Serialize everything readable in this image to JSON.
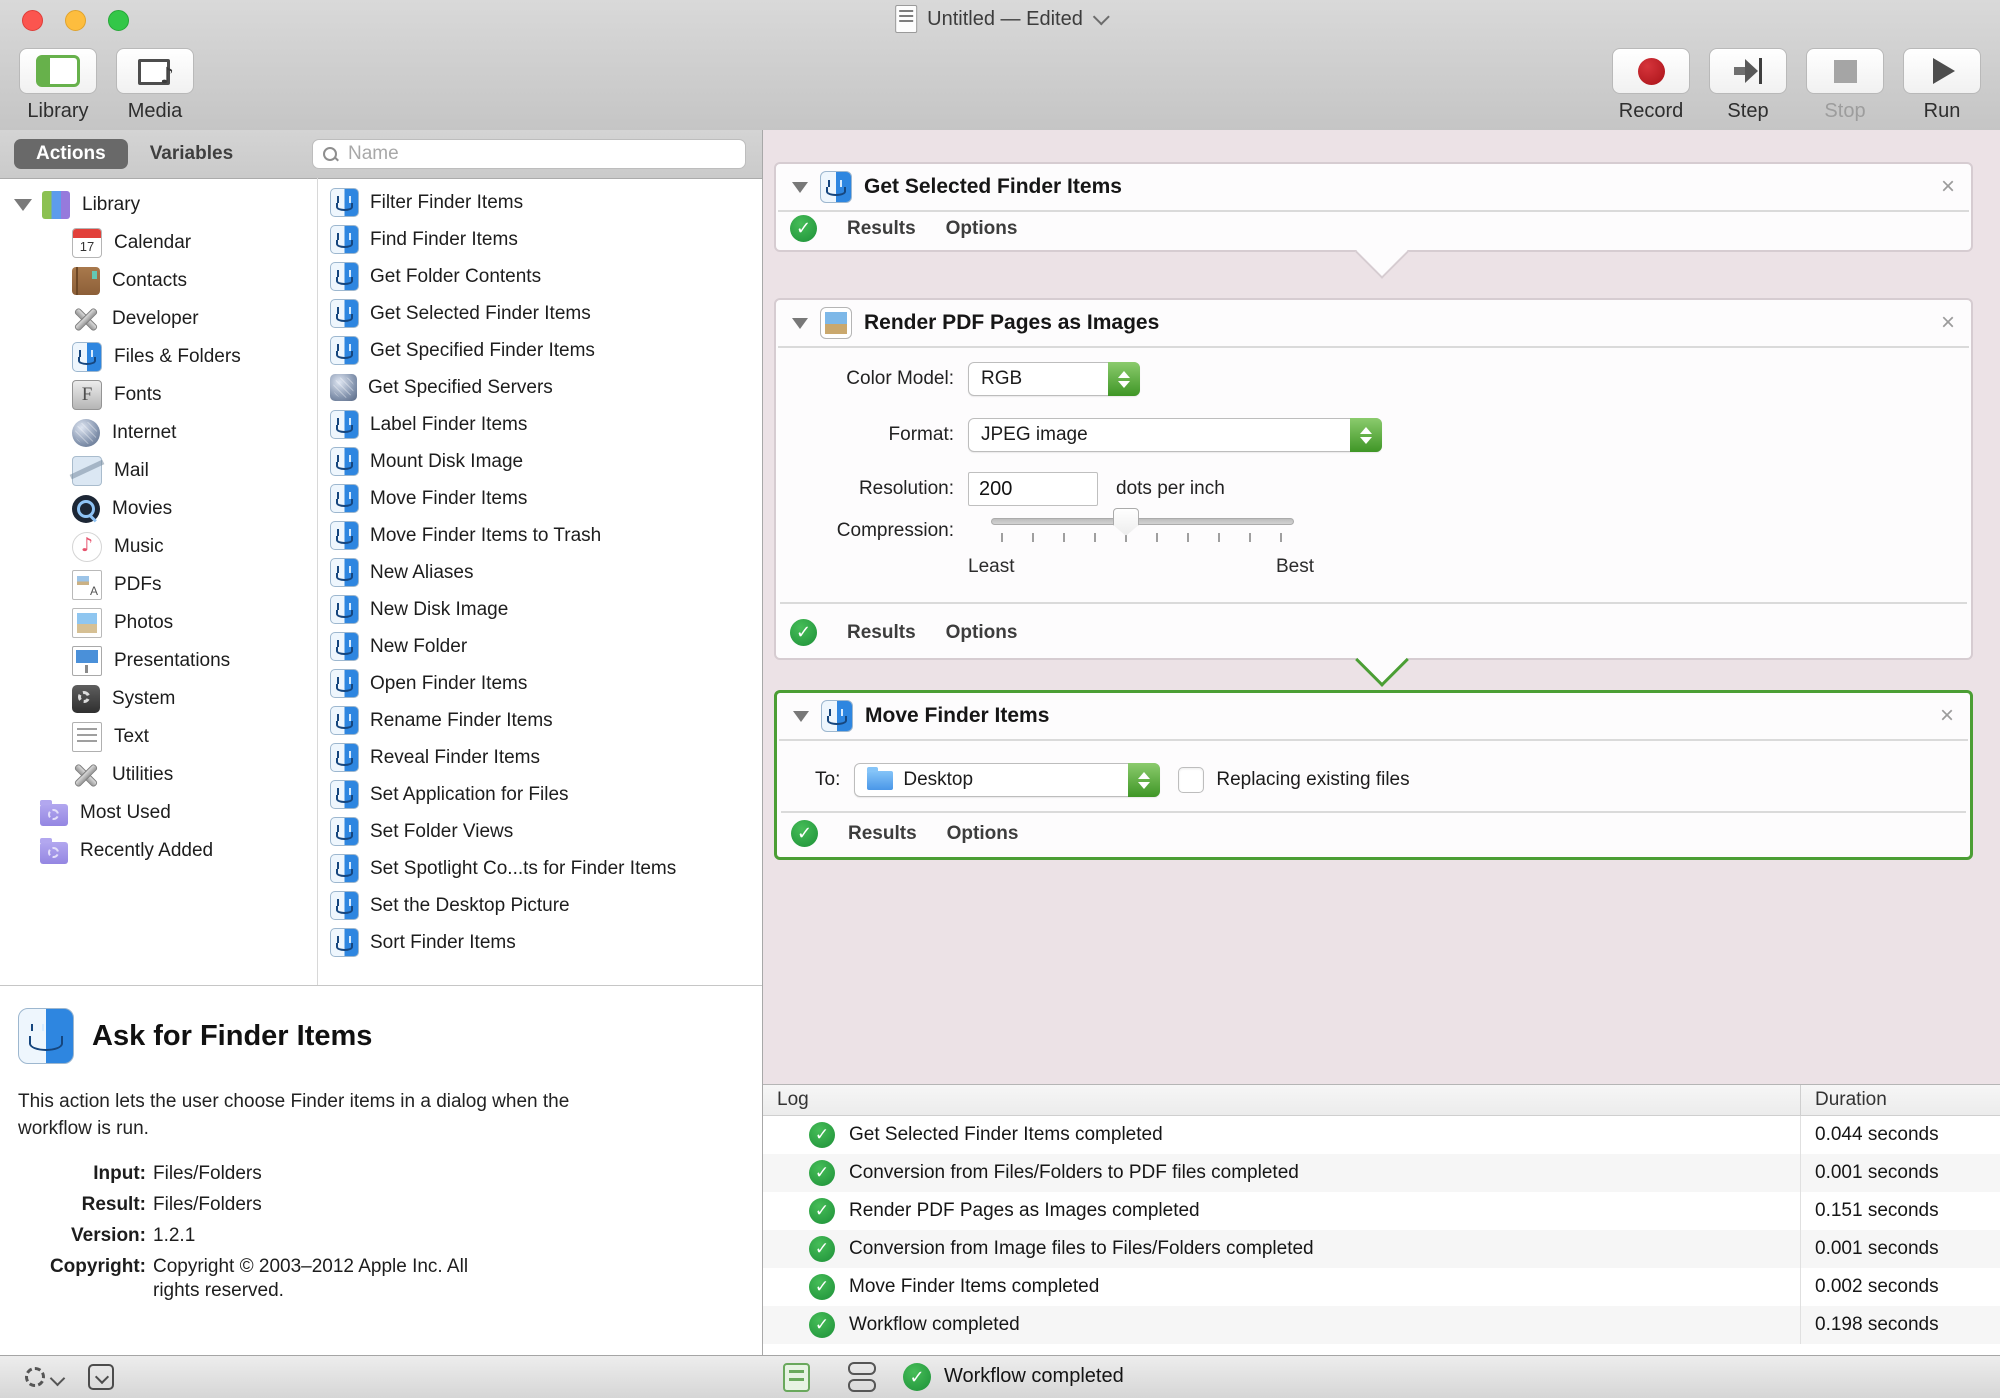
{
  "window": {
    "title": "Untitled — Edited"
  },
  "toolbar": {
    "library_label": "Library",
    "media_label": "Media",
    "record_label": "Record",
    "step_label": "Step",
    "stop_label": "Stop",
    "stop_disabled": true,
    "run_label": "Run"
  },
  "tabs": {
    "items": [
      {
        "label": "Actions",
        "selected": true
      },
      {
        "label": "Variables",
        "selected": false
      }
    ]
  },
  "search": {
    "placeholder": "Name"
  },
  "sidebar": {
    "items": [
      {
        "label": "Library",
        "icon": "library",
        "level": 0,
        "expanded": true,
        "selected": false
      },
      {
        "label": "Calendar",
        "icon": "calendar",
        "level": 1,
        "selected": false
      },
      {
        "label": "Contacts",
        "icon": "contacts",
        "level": 1,
        "selected": false
      },
      {
        "label": "Developer",
        "icon": "developer",
        "level": 1,
        "selected": false
      },
      {
        "label": "Files & Folders",
        "icon": "finder",
        "level": 1,
        "selected": true
      },
      {
        "label": "Fonts",
        "icon": "fonts",
        "level": 1,
        "selected": false
      },
      {
        "label": "Internet",
        "icon": "internet",
        "level": 1,
        "selected": false
      },
      {
        "label": "Mail",
        "icon": "mail",
        "level": 1,
        "selected": false
      },
      {
        "label": "Movies",
        "icon": "movies",
        "level": 1,
        "selected": false
      },
      {
        "label": "Music",
        "icon": "music",
        "level": 1,
        "selected": false
      },
      {
        "label": "PDFs",
        "icon": "pdfs",
        "level": 1,
        "selected": false
      },
      {
        "label": "Photos",
        "icon": "photos",
        "level": 1,
        "selected": false
      },
      {
        "label": "Presentations",
        "icon": "presentations",
        "level": 1,
        "selected": false
      },
      {
        "label": "System",
        "icon": "system",
        "level": 1,
        "selected": false
      },
      {
        "label": "Text",
        "icon": "text",
        "level": 1,
        "selected": false
      },
      {
        "label": "Utilities",
        "icon": "utilities",
        "level": 1,
        "selected": false
      },
      {
        "label": "Most Used",
        "icon": "smart-folder",
        "level": 2,
        "selected": false
      },
      {
        "label": "Recently Added",
        "icon": "smart-folder",
        "level": 2,
        "selected": false
      }
    ]
  },
  "actions_list": {
    "items": [
      {
        "label": "Filter Finder Items",
        "icon": "finder"
      },
      {
        "label": "Find Finder Items",
        "icon": "finder"
      },
      {
        "label": "Get Folder Contents",
        "icon": "finder"
      },
      {
        "label": "Get Selected Finder Items",
        "icon": "finder"
      },
      {
        "label": "Get Specified Finder Items",
        "icon": "finder"
      },
      {
        "label": "Get Specified Servers",
        "icon": "globe"
      },
      {
        "label": "Label Finder Items",
        "icon": "finder"
      },
      {
        "label": "Mount Disk Image",
        "icon": "finder"
      },
      {
        "label": "Move Finder Items",
        "icon": "finder"
      },
      {
        "label": "Move Finder Items to Trash",
        "icon": "finder"
      },
      {
        "label": "New Aliases",
        "icon": "finder"
      },
      {
        "label": "New Disk Image",
        "icon": "finder"
      },
      {
        "label": "New Folder",
        "icon": "finder"
      },
      {
        "label": "Open Finder Items",
        "icon": "finder"
      },
      {
        "label": "Rename Finder Items",
        "icon": "finder"
      },
      {
        "label": "Reveal Finder Items",
        "icon": "finder"
      },
      {
        "label": "Set Application for Files",
        "icon": "finder"
      },
      {
        "label": "Set Folder Views",
        "icon": "finder"
      },
      {
        "label": "Set Spotlight Co...ts for Finder Items",
        "icon": "finder"
      },
      {
        "label": "Set the Desktop Picture",
        "icon": "finder"
      },
      {
        "label": "Sort Finder Items",
        "icon": "finder"
      }
    ]
  },
  "workflow": {
    "cards": [
      {
        "title": "Get Selected Finder Items",
        "icon": "finder",
        "close_label": "×",
        "results_label": "Results",
        "options_label": "Options",
        "selected": false
      },
      {
        "title": "Render PDF Pages as Images",
        "icon": "render",
        "close_label": "×",
        "color_model_label": "Color Model:",
        "color_model_value": "RGB",
        "format_label": "Format:",
        "format_value": "JPEG image",
        "resolution_label": "Resolution:",
        "resolution_value": "200",
        "resolution_unit": "dots per inch",
        "compression_label": "Compression:",
        "compression_percent": 44.5,
        "compression_min_label": "Least",
        "compression_max_label": "Best",
        "results_label": "Results",
        "options_label": "Options",
        "selected": false
      },
      {
        "title": "Move Finder Items",
        "icon": "finder",
        "close_label": "×",
        "to_label": "To:",
        "to_value": "Desktop",
        "replace_label": "Replacing existing files",
        "replace_checked": false,
        "results_label": "Results",
        "options_label": "Options",
        "selected": true
      }
    ]
  },
  "log": {
    "header": {
      "log": "Log",
      "duration": "Duration"
    },
    "rows": [
      {
        "text": "Get Selected Finder Items completed",
        "duration": "0.044 seconds"
      },
      {
        "text": "Conversion from Files/Folders to PDF files completed",
        "duration": "0.001 seconds"
      },
      {
        "text": "Render PDF Pages as Images completed",
        "duration": "0.151 seconds"
      },
      {
        "text": "Conversion from Image files to Files/Folders completed",
        "duration": "0.001 seconds"
      },
      {
        "text": "Move Finder Items completed",
        "duration": "0.002 seconds"
      },
      {
        "text": "Workflow completed",
        "duration": "0.198 seconds"
      }
    ]
  },
  "description": {
    "title": "Ask for Finder Items",
    "text": "This action lets the user choose Finder items in a dialog when the workflow is run.",
    "fields": [
      {
        "label": "Input:",
        "value": "Files/Folders"
      },
      {
        "label": "Result:",
        "value": "Files/Folders"
      },
      {
        "label": "Version:",
        "value": "1.2.1"
      },
      {
        "label": "Copyright:",
        "value": "Copyright © 2003–2012 Apple Inc.  All rights reserved."
      }
    ]
  },
  "statusbar": {
    "status_text": "Workflow completed"
  },
  "colors": {
    "accent_green": "#4b9e34",
    "check_green": "#1d9038",
    "record_red": "#b01218",
    "workflow_bg": "#ece2e6"
  }
}
